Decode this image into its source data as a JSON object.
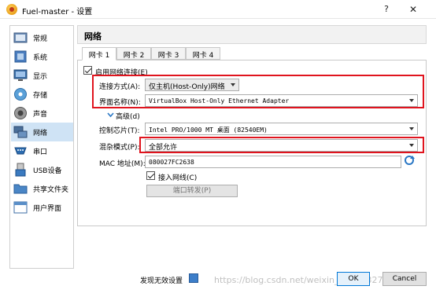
{
  "window": {
    "title": "Fuel-master - 设置",
    "help": "?",
    "close": "✕"
  },
  "sidebar": {
    "items": [
      {
        "label": "常规",
        "icon": "general-icon",
        "color": "#6e8fb8"
      },
      {
        "label": "系统",
        "icon": "system-icon",
        "color": "#4a7dbf"
      },
      {
        "label": "显示",
        "icon": "display-icon",
        "color": "#3a6ea8"
      },
      {
        "label": "存储",
        "icon": "storage-icon",
        "color": "#5aa0d8"
      },
      {
        "label": "声音",
        "icon": "audio-icon",
        "color": "#7a7a7a"
      },
      {
        "label": "网络",
        "icon": "network-icon",
        "color": "#4a6f9a",
        "active": true
      },
      {
        "label": "串口",
        "icon": "serial-port-icon",
        "color": "#2b6cb0"
      },
      {
        "label": "USB设备",
        "icon": "usb-icon",
        "color": "#3a7ac0"
      },
      {
        "label": "共享文件夹",
        "icon": "shared-folder-icon",
        "color": "#4a86c6"
      },
      {
        "label": "用户界面",
        "icon": "user-interface-icon",
        "color": "#5a8fc8"
      }
    ]
  },
  "panel": {
    "title": "网络"
  },
  "tabs": [
    {
      "label": "网卡 1",
      "active": true
    },
    {
      "label": "网卡 2"
    },
    {
      "label": "网卡 3"
    },
    {
      "label": "网卡 4"
    }
  ],
  "form": {
    "enable_label": "启用网络连接(E)",
    "attached_label": "连接方式(A):",
    "attached_value": "仅主机(Host-Only)网络",
    "name_label": "界面名称(N):",
    "name_value": "VirtualBox Host-Only Ethernet Adapter",
    "advanced_label": "高级(d)",
    "adapter_type_label": "控制芯片(T):",
    "adapter_type_value": "Intel PRO/1000 MT 桌面 (82540EM)",
    "promisc_label": "混杂模式(P):",
    "promisc_value": "全部允许",
    "mac_label": "MAC 地址(M):",
    "mac_value": "080027FC2638",
    "cable_label": "接入网线(C)",
    "port_forward_label": "端口转发(P)"
  },
  "footer": {
    "invalid_label": "发现无效设置",
    "watermark": "https://blog.csdn.net/weixin_45659327",
    "ok_label": "OK",
    "cancel_label": "Cancel"
  },
  "colors": {
    "highlight": "#e0141e",
    "selected": "#cfe3f5",
    "accent": "#0078d7"
  }
}
